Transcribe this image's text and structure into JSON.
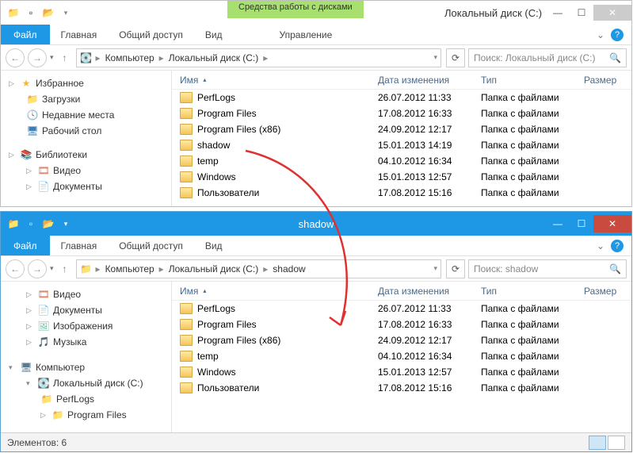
{
  "win1": {
    "ribbonContext": "Средства работы с дисками",
    "title": "Локальный диск (C:)",
    "ribbonSub": "Управление",
    "menu": {
      "file": "Файл",
      "home": "Главная",
      "share": "Общий доступ",
      "view": "Вид"
    },
    "breadcrumb": [
      "Компьютер",
      "Локальный диск (C:)"
    ],
    "searchPlaceholder": "Поиск: Локальный диск (C:)",
    "columns": {
      "name": "Имя",
      "date": "Дата изменения",
      "type": "Тип",
      "size": "Размер"
    },
    "tree": {
      "fav": "Избранное",
      "downloads": "Загрузки",
      "recent": "Недавние места",
      "desktop": "Рабочий стол",
      "libs": "Библиотеки",
      "video": "Видео",
      "docs": "Документы"
    },
    "rows": [
      {
        "name": "PerfLogs",
        "date": "26.07.2012 11:33",
        "type": "Папка с файлами"
      },
      {
        "name": "Program Files",
        "date": "17.08.2012 16:33",
        "type": "Папка с файлами"
      },
      {
        "name": "Program Files (x86)",
        "date": "24.09.2012 12:17",
        "type": "Папка с файлами"
      },
      {
        "name": "shadow",
        "date": "15.01.2013 14:19",
        "type": "Папка с файлами"
      },
      {
        "name": "temp",
        "date": "04.10.2012 16:34",
        "type": "Папка с файлами"
      },
      {
        "name": "Windows",
        "date": "15.01.2013 12:57",
        "type": "Папка с файлами"
      },
      {
        "name": "Пользователи",
        "date": "17.08.2012 15:16",
        "type": "Папка с файлами"
      }
    ]
  },
  "win2": {
    "title": "shadow",
    "menu": {
      "file": "Файл",
      "home": "Главная",
      "share": "Общий доступ",
      "view": "Вид"
    },
    "breadcrumb": [
      "Компьютер",
      "Локальный диск (C:)",
      "shadow"
    ],
    "searchPlaceholder": "Поиск: shadow",
    "columns": {
      "name": "Имя",
      "date": "Дата изменения",
      "type": "Тип",
      "size": "Размер"
    },
    "tree": {
      "video": "Видео",
      "docs": "Документы",
      "pics": "Изображения",
      "music": "Музыка",
      "computer": "Компьютер",
      "disk": "Локальный диск (C:)",
      "perflogs": "PerfLogs",
      "progfiles": "Program Files"
    },
    "rows": [
      {
        "name": "PerfLogs",
        "date": "26.07.2012 11:33",
        "type": "Папка с файлами"
      },
      {
        "name": "Program Files",
        "date": "17.08.2012 16:33",
        "type": "Папка с файлами"
      },
      {
        "name": "Program Files (x86)",
        "date": "24.09.2012 12:17",
        "type": "Папка с файлами"
      },
      {
        "name": "temp",
        "date": "04.10.2012 16:34",
        "type": "Папка с файлами"
      },
      {
        "name": "Windows",
        "date": "15.01.2013 12:57",
        "type": "Папка с файлами"
      },
      {
        "name": "Пользователи",
        "date": "17.08.2012 15:16",
        "type": "Папка с файлами"
      }
    ],
    "status": "Элементов: 6"
  }
}
